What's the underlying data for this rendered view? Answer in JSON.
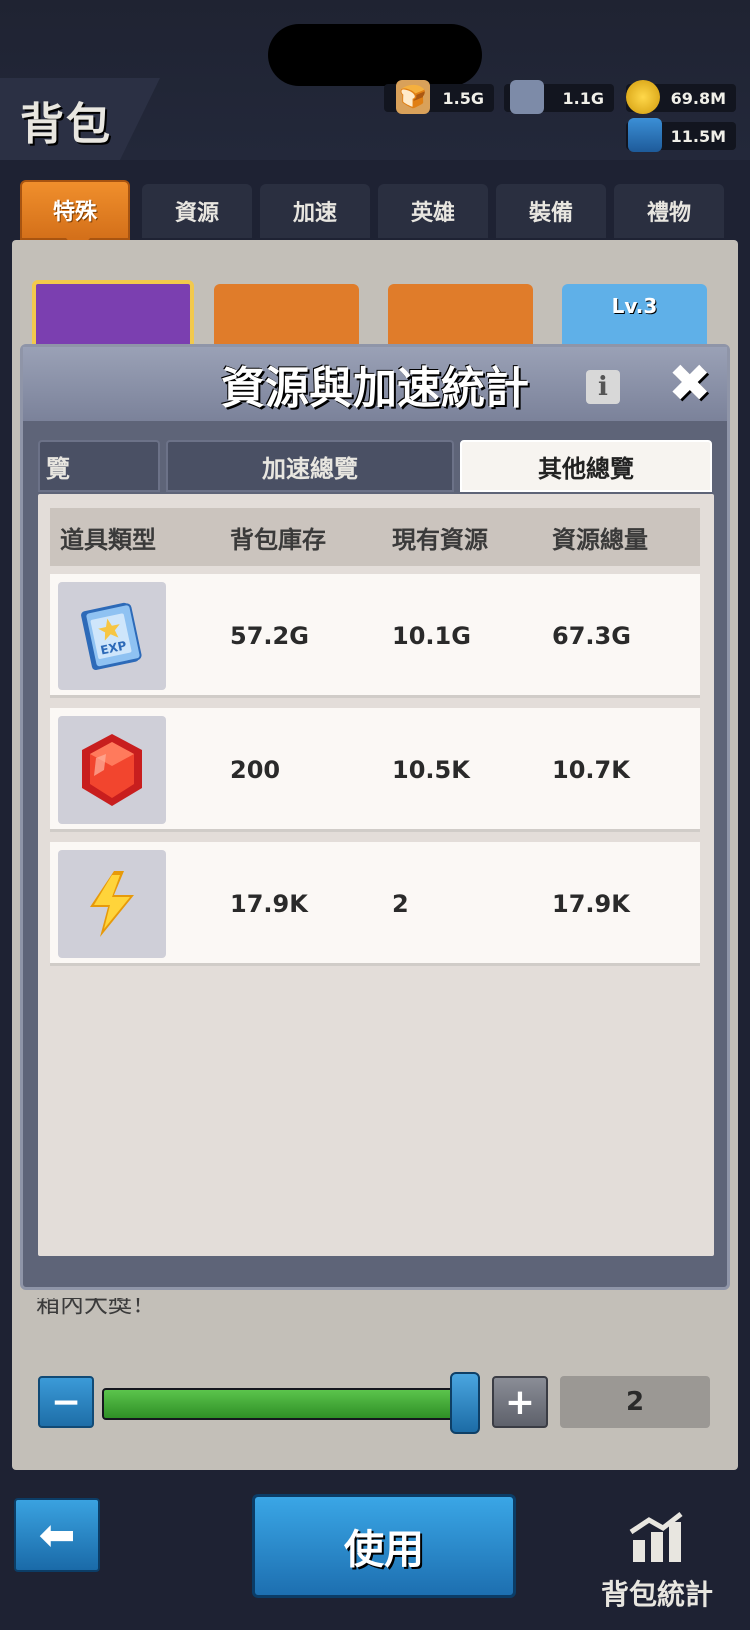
{
  "header": {
    "title": "背包",
    "resources": [
      {
        "name": "wood",
        "icon": "bread-icon",
        "value": "1.5G"
      },
      {
        "name": "iron",
        "icon": "iron-ingot-icon",
        "value": "1.1G"
      },
      {
        "name": "gold",
        "icon": "gold-coin-icon",
        "value": "69.8M"
      },
      {
        "name": "oil",
        "icon": "oil-barrel-icon",
        "value": "11.5M"
      }
    ]
  },
  "tabs": [
    "特殊",
    "資源",
    "加速",
    "英雄",
    "裝備",
    "禮物"
  ],
  "active_tab": "特殊",
  "item_cards": [
    {
      "label": ""
    },
    {
      "label": ""
    },
    {
      "label": ""
    },
    {
      "label": "Lv.3"
    }
  ],
  "modal": {
    "title": "資源與加速統計",
    "tabs": [
      "覽",
      "加速總覽",
      "其他總覽"
    ],
    "active_tab": "其他總覽",
    "columns": [
      "道具類型",
      "背包庫存",
      "現有資源",
      "資源總量"
    ],
    "rows": [
      {
        "icon": "exp-book-icon",
        "backpack": "57.2G",
        "current": "10.1G",
        "total": "67.3G"
      },
      {
        "icon": "red-gem-icon",
        "backpack": "200",
        "current": "10.5K",
        "total": "10.7K"
      },
      {
        "icon": "lightning-icon",
        "backpack": "17.9K",
        "current": "2",
        "total": "17.9K"
      }
    ]
  },
  "footer": {
    "partial_text": "箱內大獎！",
    "quantity": "2",
    "slider_fraction": 1.0,
    "use_label": "使用",
    "stats_label": "背包統計"
  }
}
